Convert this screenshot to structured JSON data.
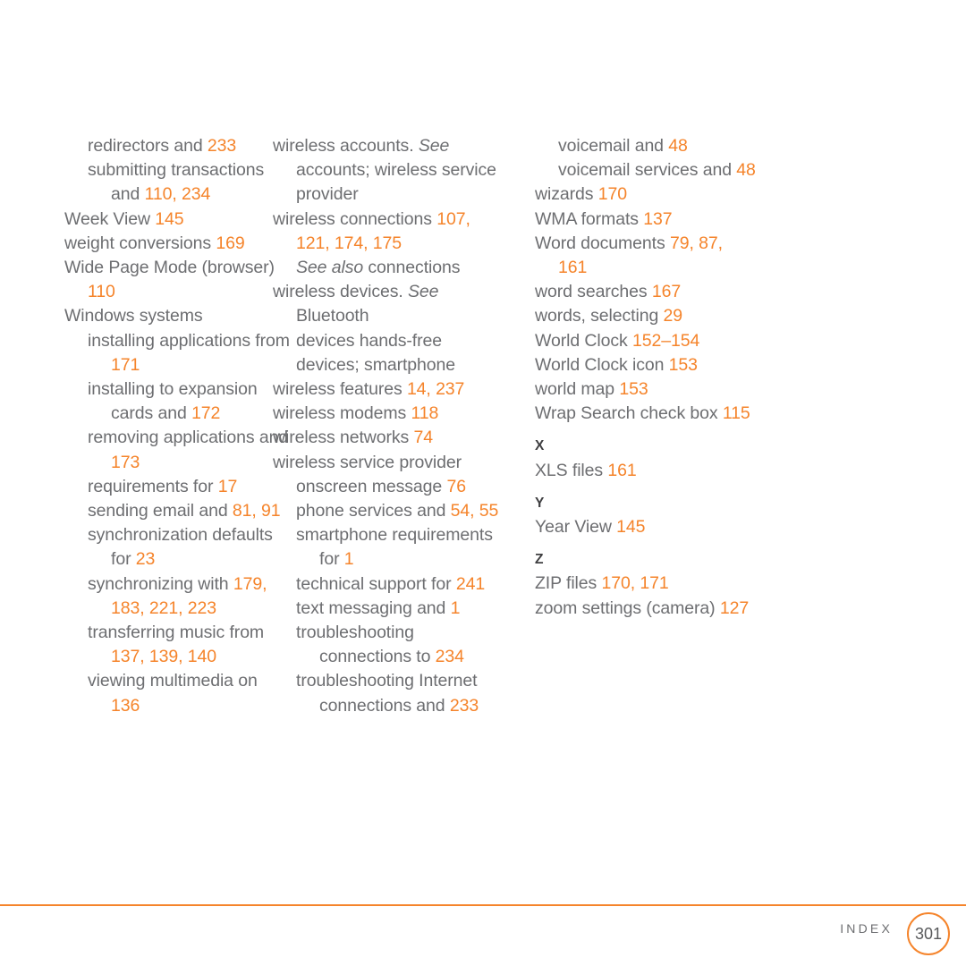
{
  "page": {
    "background": "#ffffff",
    "text_color": "#6d6e71",
    "accent_color": "#f5842b"
  },
  "footer": {
    "label": "INDEX",
    "page_number": "301"
  },
  "columns": [
    {
      "id": "column-1",
      "lines": [
        {
          "indent": 1,
          "parts": [
            {
              "t": "redirectors and ",
              "k": "text"
            },
            {
              "t": "233",
              "k": "page"
            }
          ]
        },
        {
          "indent": 1,
          "parts": [
            {
              "t": "submitting transactions",
              "k": "text"
            }
          ]
        },
        {
          "indent": 2,
          "parts": [
            {
              "t": "and ",
              "k": "text"
            },
            {
              "t": "110, 234",
              "k": "page"
            }
          ]
        },
        {
          "indent": 0,
          "parts": [
            {
              "t": "Week View ",
              "k": "text"
            },
            {
              "t": "145",
              "k": "page"
            }
          ]
        },
        {
          "indent": 0,
          "parts": [
            {
              "t": "weight conversions ",
              "k": "text"
            },
            {
              "t": "169",
              "k": "page"
            }
          ]
        },
        {
          "indent": 0,
          "parts": [
            {
              "t": "Wide Page Mode (browser)",
              "k": "text"
            }
          ]
        },
        {
          "indent": 1,
          "parts": [
            {
              "t": "110",
              "k": "page"
            }
          ]
        },
        {
          "indent": 0,
          "parts": [
            {
              "t": "Windows systems",
              "k": "text"
            }
          ]
        },
        {
          "indent": 1,
          "parts": [
            {
              "t": "installing applications from",
              "k": "text"
            }
          ]
        },
        {
          "indent": 2,
          "parts": [
            {
              "t": "171",
              "k": "page"
            }
          ]
        },
        {
          "indent": 1,
          "parts": [
            {
              "t": "installing to expansion",
              "k": "text"
            }
          ]
        },
        {
          "indent": 2,
          "parts": [
            {
              "t": "cards and ",
              "k": "text"
            },
            {
              "t": "172",
              "k": "page"
            }
          ]
        },
        {
          "indent": 1,
          "parts": [
            {
              "t": "removing applications and",
              "k": "text"
            }
          ]
        },
        {
          "indent": 2,
          "parts": [
            {
              "t": "173",
              "k": "page"
            }
          ]
        },
        {
          "indent": 1,
          "parts": [
            {
              "t": "requirements for ",
              "k": "text"
            },
            {
              "t": "17",
              "k": "page"
            }
          ]
        },
        {
          "indent": 1,
          "parts": [
            {
              "t": "sending email and ",
              "k": "text"
            },
            {
              "t": "81, 91",
              "k": "page"
            }
          ]
        },
        {
          "indent": 1,
          "parts": [
            {
              "t": "synchronization defaults",
              "k": "text"
            }
          ]
        },
        {
          "indent": 2,
          "parts": [
            {
              "t": "for ",
              "k": "text"
            },
            {
              "t": "23",
              "k": "page"
            }
          ]
        },
        {
          "indent": 1,
          "parts": [
            {
              "t": "synchronizing with ",
              "k": "text"
            },
            {
              "t": "179,",
              "k": "page"
            }
          ]
        },
        {
          "indent": 2,
          "parts": [
            {
              "t": "183, 221, 223",
              "k": "page"
            }
          ]
        },
        {
          "indent": 1,
          "parts": [
            {
              "t": "transferring music from",
              "k": "text"
            }
          ]
        },
        {
          "indent": 2,
          "parts": [
            {
              "t": "137, 139, 140",
              "k": "page"
            }
          ]
        },
        {
          "indent": 1,
          "parts": [
            {
              "t": "viewing multimedia on",
              "k": "text"
            }
          ]
        },
        {
          "indent": 2,
          "parts": [
            {
              "t": "136",
              "k": "page"
            }
          ]
        }
      ]
    },
    {
      "id": "column-2",
      "lines": [
        {
          "indent": 0,
          "parts": [
            {
              "t": "wireless accounts. ",
              "k": "text"
            },
            {
              "t": "See",
              "k": "italic"
            }
          ]
        },
        {
          "indent": 1,
          "parts": [
            {
              "t": "accounts; wireless service",
              "k": "text"
            }
          ]
        },
        {
          "indent": 1,
          "parts": [
            {
              "t": "provider",
              "k": "text"
            }
          ]
        },
        {
          "indent": 0,
          "parts": [
            {
              "t": "wireless connections ",
              "k": "text"
            },
            {
              "t": "107,",
              "k": "page"
            }
          ]
        },
        {
          "indent": 1,
          "parts": [
            {
              "t": "121, 174, 175",
              "k": "page"
            }
          ]
        },
        {
          "indent": 1,
          "parts": [
            {
              "t": "See also",
              "k": "italic"
            },
            {
              "t": " connections",
              "k": "text"
            }
          ]
        },
        {
          "indent": 0,
          "parts": [
            {
              "t": "wireless devices. ",
              "k": "text"
            },
            {
              "t": "See",
              "k": "italic"
            }
          ]
        },
        {
          "indent": 1,
          "parts": [
            {
              "t": "Bluetooth",
              "k": "text"
            }
          ]
        },
        {
          "indent": 1,
          "parts": [
            {
              "t": "devices hands-free",
              "k": "text"
            }
          ]
        },
        {
          "indent": 1,
          "parts": [
            {
              "t": "devices; smartphone",
              "k": "text"
            }
          ]
        },
        {
          "indent": 0,
          "parts": [
            {
              "t": "wireless features ",
              "k": "text"
            },
            {
              "t": "14, 237",
              "k": "page"
            }
          ]
        },
        {
          "indent": 0,
          "parts": [
            {
              "t": "wireless modems ",
              "k": "text"
            },
            {
              "t": "118",
              "k": "page"
            }
          ]
        },
        {
          "indent": 0,
          "parts": [
            {
              "t": "wireless networks ",
              "k": "text"
            },
            {
              "t": "74",
              "k": "page"
            }
          ]
        },
        {
          "indent": 0,
          "parts": [
            {
              "t": "wireless service provider",
              "k": "text"
            }
          ]
        },
        {
          "indent": 1,
          "parts": [
            {
              "t": "onscreen message ",
              "k": "text"
            },
            {
              "t": "76",
              "k": "page"
            }
          ]
        },
        {
          "indent": 1,
          "parts": [
            {
              "t": "phone services and ",
              "k": "text"
            },
            {
              "t": "54, 55",
              "k": "page"
            }
          ]
        },
        {
          "indent": 1,
          "parts": [
            {
              "t": "smartphone requirements",
              "k": "text"
            }
          ]
        },
        {
          "indent": 2,
          "parts": [
            {
              "t": "for ",
              "k": "text"
            },
            {
              "t": "1",
              "k": "page"
            }
          ]
        },
        {
          "indent": 1,
          "parts": [
            {
              "t": "technical support for ",
              "k": "text"
            },
            {
              "t": "241",
              "k": "page"
            }
          ]
        },
        {
          "indent": 1,
          "parts": [
            {
              "t": "text messaging and ",
              "k": "text"
            },
            {
              "t": "1",
              "k": "page"
            }
          ]
        },
        {
          "indent": 1,
          "parts": [
            {
              "t": "troubleshooting",
              "k": "text"
            }
          ]
        },
        {
          "indent": 2,
          "parts": [
            {
              "t": "connections to ",
              "k": "text"
            },
            {
              "t": "234",
              "k": "page"
            }
          ]
        },
        {
          "indent": 1,
          "parts": [
            {
              "t": "troubleshooting Internet",
              "k": "text"
            }
          ]
        },
        {
          "indent": 2,
          "parts": [
            {
              "t": "connections and ",
              "k": "text"
            },
            {
              "t": "233",
              "k": "page"
            }
          ]
        }
      ]
    },
    {
      "id": "column-3",
      "lines": [
        {
          "indent": 1,
          "parts": [
            {
              "t": "voicemail and ",
              "k": "text"
            },
            {
              "t": "48",
              "k": "page"
            }
          ]
        },
        {
          "indent": 1,
          "parts": [
            {
              "t": "voicemail services and ",
              "k": "text"
            },
            {
              "t": "48",
              "k": "page"
            }
          ]
        },
        {
          "indent": 0,
          "parts": [
            {
              "t": "wizards ",
              "k": "text"
            },
            {
              "t": "170",
              "k": "page"
            }
          ]
        },
        {
          "indent": 0,
          "parts": [
            {
              "t": "WMA formats ",
              "k": "text"
            },
            {
              "t": "137",
              "k": "page"
            }
          ]
        },
        {
          "indent": 0,
          "parts": [
            {
              "t": "Word documents ",
              "k": "text"
            },
            {
              "t": "79, 87,",
              "k": "page"
            }
          ]
        },
        {
          "indent": 1,
          "parts": [
            {
              "t": "161",
              "k": "page"
            }
          ]
        },
        {
          "indent": 0,
          "parts": [
            {
              "t": "word searches ",
              "k": "text"
            },
            {
              "t": "167",
              "k": "page"
            }
          ]
        },
        {
          "indent": 0,
          "parts": [
            {
              "t": "words, selecting ",
              "k": "text"
            },
            {
              "t": "29",
              "k": "page"
            }
          ]
        },
        {
          "indent": 0,
          "parts": [
            {
              "t": "World Clock ",
              "k": "text"
            },
            {
              "t": "152–154",
              "k": "page"
            }
          ]
        },
        {
          "indent": 0,
          "parts": [
            {
              "t": "World Clock icon ",
              "k": "text"
            },
            {
              "t": "153",
              "k": "page"
            }
          ]
        },
        {
          "indent": 0,
          "parts": [
            {
              "t": "world map ",
              "k": "text"
            },
            {
              "t": "153",
              "k": "page"
            }
          ]
        },
        {
          "indent": 0,
          "parts": [
            {
              "t": "Wrap Search check box ",
              "k": "text"
            },
            {
              "t": "115",
              "k": "page"
            }
          ]
        },
        {
          "kind": "section",
          "label": "X"
        },
        {
          "indent": 0,
          "parts": [
            {
              "t": "XLS files ",
              "k": "text"
            },
            {
              "t": "161",
              "k": "page"
            }
          ]
        },
        {
          "kind": "section",
          "label": "Y"
        },
        {
          "indent": 0,
          "parts": [
            {
              "t": "Year View ",
              "k": "text"
            },
            {
              "t": "145",
              "k": "page"
            }
          ]
        },
        {
          "kind": "section",
          "label": "Z"
        },
        {
          "indent": 0,
          "parts": [
            {
              "t": "ZIP files ",
              "k": "text"
            },
            {
              "t": "170, 171",
              "k": "page"
            }
          ]
        },
        {
          "indent": 0,
          "parts": [
            {
              "t": "zoom settings (camera) ",
              "k": "text"
            },
            {
              "t": "127",
              "k": "page"
            }
          ]
        }
      ]
    }
  ]
}
